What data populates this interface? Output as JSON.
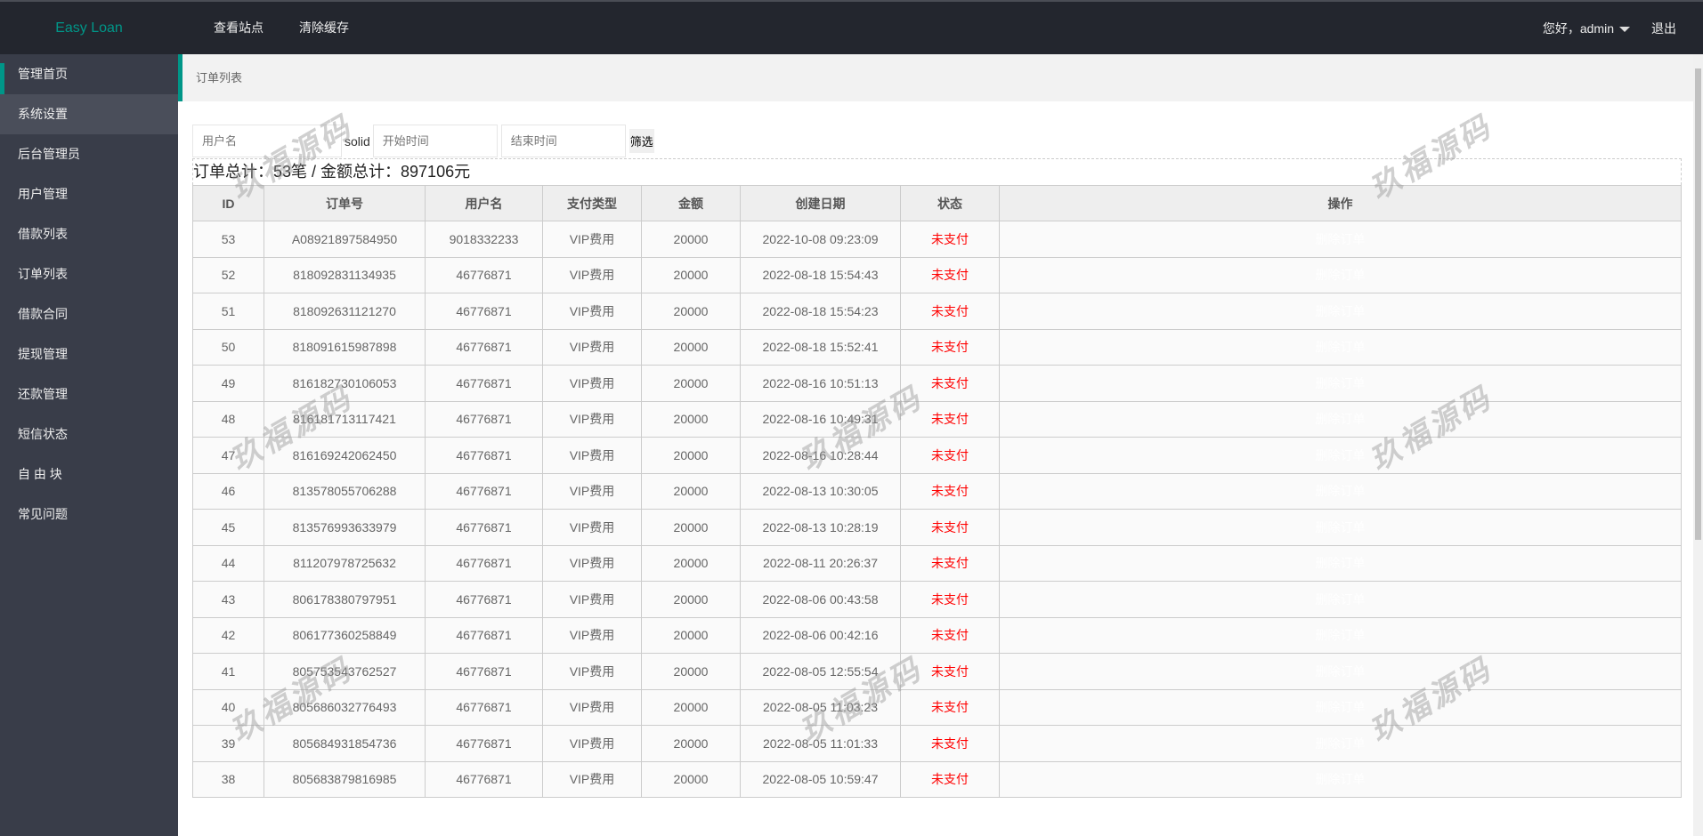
{
  "header": {
    "logo": "Easy Loan",
    "nav": [
      "查看站点",
      "清除缓存"
    ],
    "greeting": "您好，admin",
    "logout": "退出"
  },
  "sidebar": {
    "items": [
      "管理首页",
      "系统设置",
      "后台管理员",
      "用户管理",
      "借款列表",
      "订单列表",
      "借款合同",
      "提现管理",
      "还款管理",
      "短信状态",
      "自 由 块",
      "常见问题"
    ]
  },
  "breadcrumb": "订单列表",
  "filters": {
    "username_placeholder": "用户名",
    "solid_text": "solid",
    "start_placeholder": "开始时间",
    "end_placeholder": "结束时间",
    "filter_button": "筛选"
  },
  "summary": "订单总计：53笔 / 金额总计：897106元",
  "table": {
    "headers": [
      "ID",
      "订单号",
      "用户名",
      "支付类型",
      "金额",
      "创建日期",
      "状态",
      "操作"
    ],
    "rows": [
      [
        "53",
        "A08921897584950",
        "9018332233",
        "VIP费用",
        "20000",
        "2022-10-08 09:23:09",
        "未支付",
        "删除订单"
      ],
      [
        "52",
        "818092831134935",
        "46776871",
        "VIP费用",
        "20000",
        "2022-08-18 15:54:43",
        "未支付",
        "删除订单"
      ],
      [
        "51",
        "818092631121270",
        "46776871",
        "VIP费用",
        "20000",
        "2022-08-18 15:54:23",
        "未支付",
        "删除订单"
      ],
      [
        "50",
        "818091615987898",
        "46776871",
        "VIP费用",
        "20000",
        "2022-08-18 15:52:41",
        "未支付",
        "删除订单"
      ],
      [
        "49",
        "816182730106053",
        "46776871",
        "VIP费用",
        "20000",
        "2022-08-16 10:51:13",
        "未支付",
        "删除订单"
      ],
      [
        "48",
        "816181713117421",
        "46776871",
        "VIP费用",
        "20000",
        "2022-08-16 10:49:31",
        "未支付",
        "删除订单"
      ],
      [
        "47",
        "816169242062450",
        "46776871",
        "VIP费用",
        "20000",
        "2022-08-16 10:28:44",
        "未支付",
        "删除订单"
      ],
      [
        "46",
        "813578055706288",
        "46776871",
        "VIP费用",
        "20000",
        "2022-08-13 10:30:05",
        "未支付",
        "删除订单"
      ],
      [
        "45",
        "813576993633979",
        "46776871",
        "VIP费用",
        "20000",
        "2022-08-13 10:28:19",
        "未支付",
        "删除订单"
      ],
      [
        "44",
        "811207978725632",
        "46776871",
        "VIP费用",
        "20000",
        "2022-08-11 20:26:37",
        "未支付",
        "删除订单"
      ],
      [
        "43",
        "806178380797951",
        "46776871",
        "VIP费用",
        "20000",
        "2022-08-06 00:43:58",
        "未支付",
        "删除订单"
      ],
      [
        "42",
        "806177360258849",
        "46776871",
        "VIP费用",
        "20000",
        "2022-08-06 00:42:16",
        "未支付",
        "删除订单"
      ],
      [
        "41",
        "805753543762527",
        "46776871",
        "VIP费用",
        "20000",
        "2022-08-05 12:55:54",
        "未支付",
        "删除订单"
      ],
      [
        "40",
        "805686032776493",
        "46776871",
        "VIP费用",
        "20000",
        "2022-08-05 11:03:23",
        "未支付",
        "删除订单"
      ],
      [
        "39",
        "805684931854736",
        "46776871",
        "VIP费用",
        "20000",
        "2022-08-05 11:01:33",
        "未支付",
        "删除订单"
      ],
      [
        "38",
        "805683879816985",
        "46776871",
        "VIP费用",
        "20000",
        "2022-08-05 10:59:47",
        "未支付",
        "删除订单"
      ]
    ]
  },
  "watermark": "玖福源码",
  "colors": {
    "accent": "#009688",
    "topbar": "#23262e",
    "sidebar": "#393d49",
    "unpaid": "#ff0000"
  }
}
